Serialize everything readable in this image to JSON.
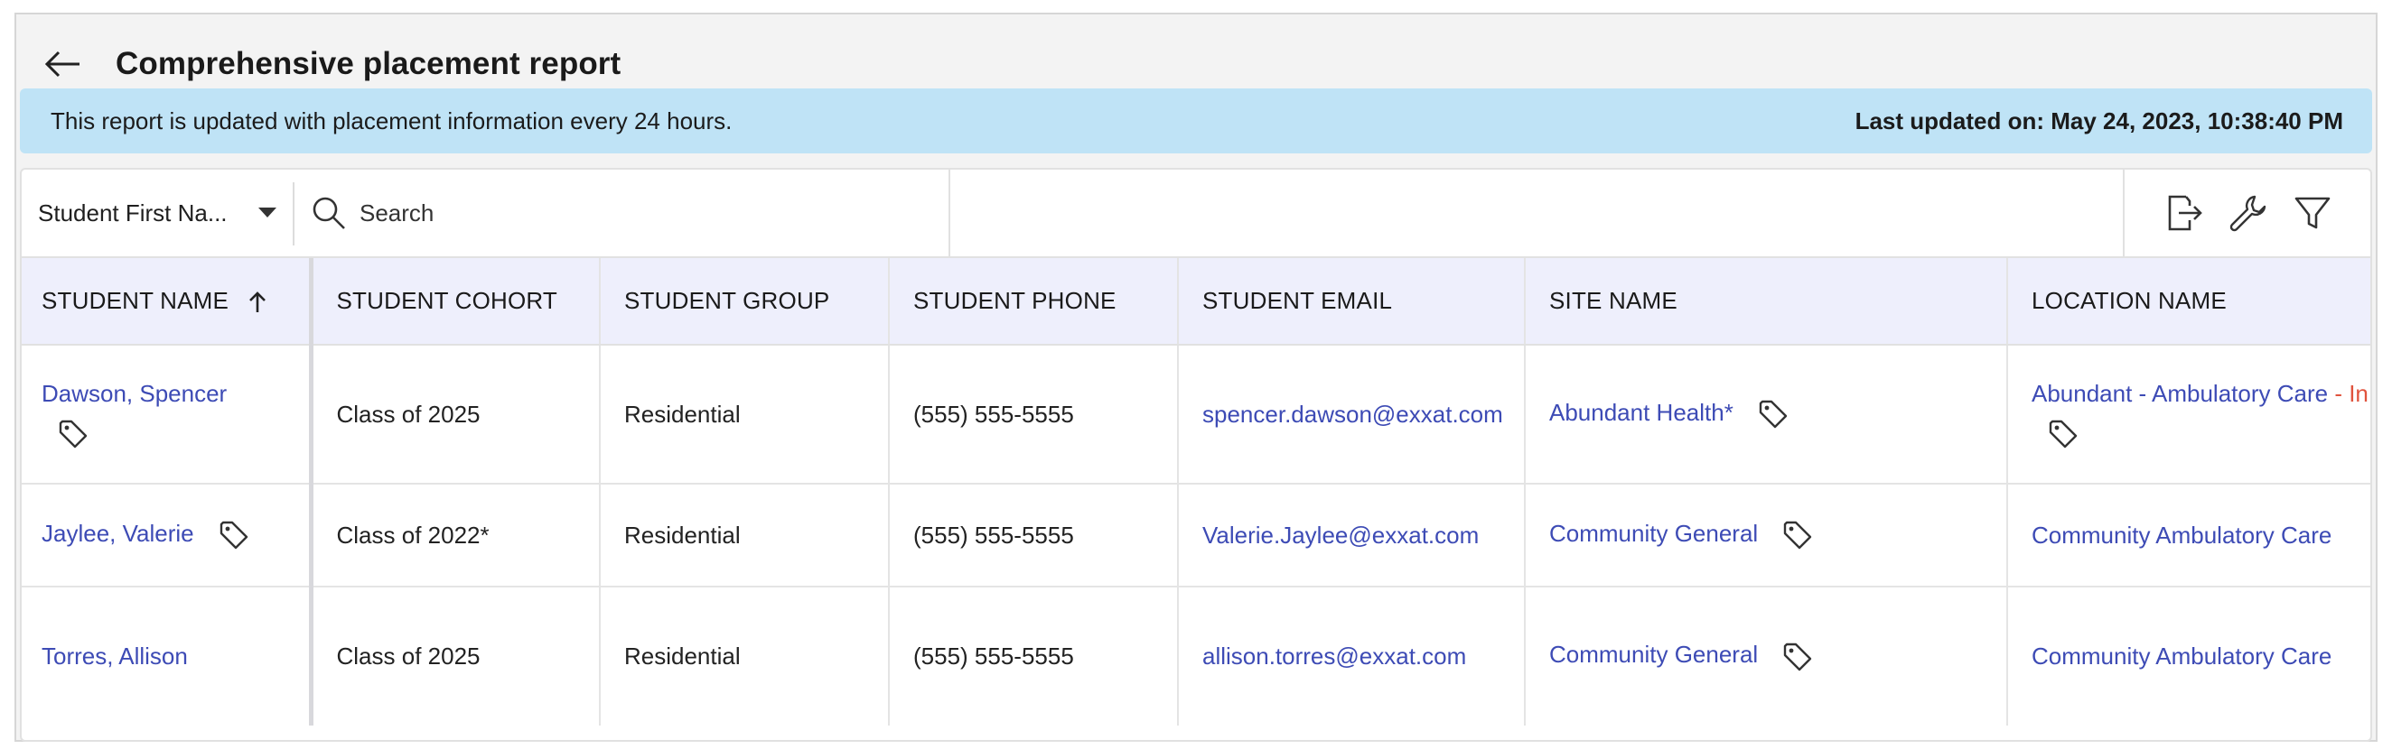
{
  "page": {
    "title": "Comprehensive placement report"
  },
  "banner": {
    "message": "This report is updated with placement information every 24 hours.",
    "last_updated": "Last updated on: May 24, 2023, 10:38:40 PM"
  },
  "toolbar": {
    "field_select_value": "Student First Na...",
    "search_placeholder": "Search",
    "tools": [
      "export-icon",
      "wrench-icon",
      "filter-icon"
    ]
  },
  "table": {
    "columns": [
      "STUDENT NAME",
      "STUDENT COHORT",
      "STUDENT GROUP",
      "STUDENT PHONE",
      "STUDENT EMAIL",
      "SITE NAME",
      "LOCATION NAME"
    ],
    "sort": {
      "column": "STUDENT NAME",
      "direction": "ascending"
    },
    "rows": [
      {
        "student_name": "Dawson, Spencer",
        "cohort": "Class of 2025",
        "group": "Residential",
        "phone": "(555) 555-5555",
        "email": "spencer.dawson@exxat.com",
        "site": "Abundant Health*",
        "location": "Abundant - Ambulatory Care",
        "location_status": "- In"
      },
      {
        "student_name": "Jaylee, Valerie",
        "cohort": "Class of 2022*",
        "group": "Residential",
        "phone": "(555) 555-5555",
        "email": "Valerie.Jaylee@exxat.com",
        "site": "Community General",
        "location": "Community Ambulatory Care"
      },
      {
        "student_name": "Torres, Allison",
        "cohort": "Class of 2025",
        "group": "Residential",
        "phone": "(555) 555-5555",
        "email": "allison.torres@exxat.com",
        "site": "Community General",
        "location": "Community Ambulatory Care"
      }
    ]
  },
  "colors": {
    "link": "#3d4bb5",
    "banner_bg": "#bfe3f6",
    "header_bg": "#eeeffc",
    "inactive": "#e0533d"
  }
}
